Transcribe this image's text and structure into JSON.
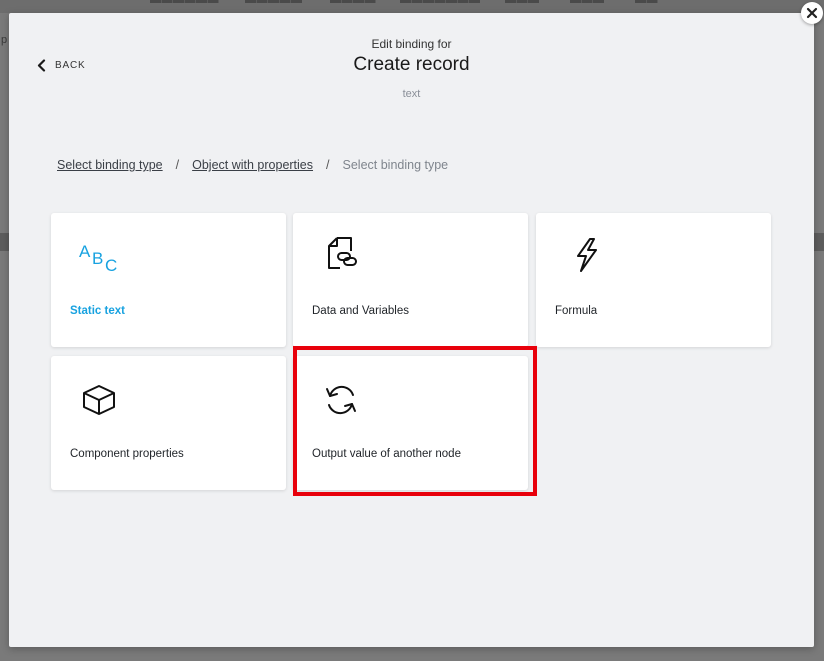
{
  "background": {
    "left_text": "p"
  },
  "modal": {
    "back_label": "BACK",
    "subtitle": "Edit binding for",
    "title": "Create record",
    "context": "text",
    "breadcrumb": [
      {
        "label": "Select binding type",
        "link": true
      },
      {
        "label": "Object with properties",
        "link": true
      },
      {
        "label": "Select binding type",
        "link": false
      }
    ],
    "breadcrumb_separator": "/",
    "cards": [
      {
        "label": "Static text",
        "icon": "abc-text-icon",
        "active": true
      },
      {
        "label": "Data and Variables",
        "icon": "linked-document-icon",
        "active": false
      },
      {
        "label": "Formula",
        "icon": "lightning-bolt-icon",
        "active": false
      },
      {
        "label": "Component properties",
        "icon": "cube-icon",
        "active": false
      },
      {
        "label": "Output value of another node",
        "icon": "refresh-cycle-icon",
        "active": false,
        "highlighted": true
      }
    ]
  },
  "colors": {
    "accent": "#18a2e0",
    "highlight": "#e8000b",
    "modal_bg": "#f0f1f3"
  }
}
